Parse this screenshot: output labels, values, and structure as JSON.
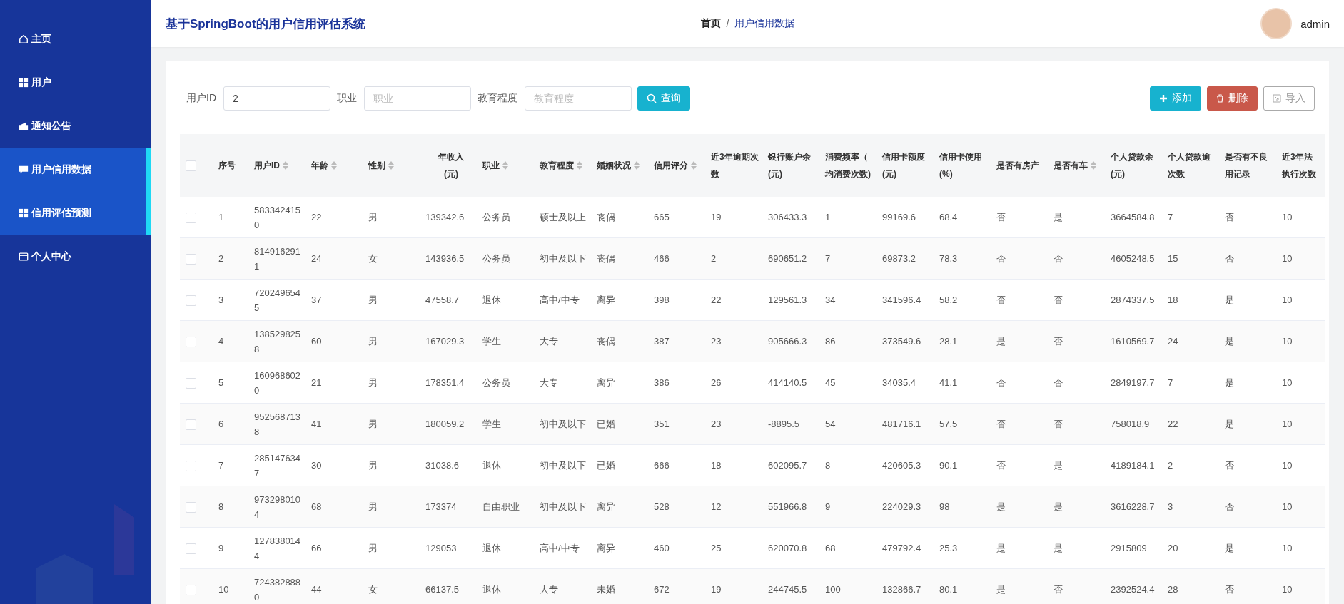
{
  "sidebar": {
    "items": [
      {
        "label": "主页",
        "kind": "home",
        "selected": false
      },
      {
        "label": "用户",
        "kind": "grid",
        "selected": false
      },
      {
        "label": "通知公告",
        "kind": "wallet",
        "selected": false
      },
      {
        "label": "用户信用数据",
        "kind": "chat",
        "selected": true
      },
      {
        "label": "信用评估预测",
        "kind": "grid",
        "selected": true
      },
      {
        "label": "个人中心",
        "kind": "card",
        "selected": false
      }
    ]
  },
  "header": {
    "title": "基于SpringBoot的用户信用评估系统",
    "breadcrumb": [
      "首页",
      "/",
      "用户信用数据"
    ],
    "user": "admin"
  },
  "filters": [
    {
      "label": "用户ID",
      "value": "2"
    },
    {
      "label": "职业",
      "placeholder": "职业"
    },
    {
      "label": "教育程度",
      "placeholder": "教育程度"
    }
  ],
  "search_button": "查询",
  "actions": [
    {
      "label": "添加",
      "kind": "add"
    },
    {
      "label": "删除",
      "kind": "delete"
    },
    {
      "label": "导入",
      "kind": "import"
    }
  ],
  "table": {
    "all_checked": false,
    "columns": [
      {
        "lines": [
          "序号"
        ],
        "sortable": false
      },
      {
        "lines": [
          "用户ID"
        ],
        "sortable": true
      },
      {
        "lines": [
          "年龄"
        ],
        "sortable": true
      },
      {
        "lines": [
          "性别"
        ],
        "sortable": true
      },
      {
        "lines": [
          "年收入",
          "(元)"
        ],
        "sortable": false
      },
      {
        "lines": [
          "职业"
        ],
        "sortable": true
      },
      {
        "lines": [
          "教育程度"
        ],
        "sortable": true
      },
      {
        "lines": [
          "婚姻状况"
        ],
        "sortable": true
      },
      {
        "lines": [
          "信用评分"
        ],
        "sortable": true
      },
      {
        "lines": [
          "近3年逾期次",
          "数"
        ],
        "sortable": false
      },
      {
        "lines": [
          "银行账户余",
          "(元)"
        ],
        "sortable": false
      },
      {
        "lines": [
          "消费频率（",
          "均消费次数)"
        ],
        "sortable": false
      },
      {
        "lines": [
          "信用卡额度",
          "(元)"
        ],
        "sortable": false
      },
      {
        "lines": [
          "信用卡使用",
          "(%)"
        ],
        "sortable": false
      },
      {
        "lines": [
          "是否有房产"
        ],
        "sortable": false
      },
      {
        "lines": [
          "是否有车"
        ],
        "sortable": true
      },
      {
        "lines": [
          "个人贷款余",
          "(元)"
        ],
        "sortable": false
      },
      {
        "lines": [
          "个人贷款逾",
          "次数"
        ],
        "sortable": false
      },
      {
        "lines": [
          "是否有不良",
          "用记录"
        ],
        "sortable": false
      },
      {
        "lines": [
          "近3年法",
          "执行次数"
        ],
        "sortable": false
      }
    ],
    "rows": [
      {
        "checked": false,
        "cells": [
          "1",
          "5833424150",
          "22",
          "男",
          "139342.6",
          "公务员",
          "硕士及以上",
          "丧偶",
          "665",
          "19",
          "306433.3",
          "1",
          "99169.6",
          "68.4",
          "否",
          "是",
          "3664584.8",
          "7",
          "否",
          "10"
        ]
      },
      {
        "checked": false,
        "cells": [
          "2",
          "8149162911",
          "24",
          "女",
          "143936.5",
          "公务员",
          "初中及以下",
          "丧偶",
          "466",
          "2",
          "690651.2",
          "7",
          "69873.2",
          "78.3",
          "否",
          "否",
          "4605248.5",
          "15",
          "否",
          "10"
        ]
      },
      {
        "checked": false,
        "cells": [
          "3",
          "7202496545",
          "37",
          "男",
          "47558.7",
          "退休",
          "高中/中专",
          "离异",
          "398",
          "22",
          "129561.3",
          "34",
          "341596.4",
          "58.2",
          "否",
          "否",
          "2874337.5",
          "18",
          "是",
          "10"
        ]
      },
      {
        "checked": false,
        "cells": [
          "4",
          "1385298258",
          "60",
          "男",
          "167029.3",
          "学生",
          "大专",
          "丧偶",
          "387",
          "23",
          "905666.3",
          "86",
          "373549.6",
          "28.1",
          "是",
          "否",
          "1610569.7",
          "24",
          "是",
          "10"
        ]
      },
      {
        "checked": false,
        "cells": [
          "5",
          "1609686020",
          "21",
          "男",
          "178351.4",
          "公务员",
          "大专",
          "离异",
          "386",
          "26",
          "414140.5",
          "45",
          "34035.4",
          "41.1",
          "否",
          "否",
          "2849197.7",
          "7",
          "是",
          "10"
        ]
      },
      {
        "checked": false,
        "cells": [
          "6",
          "9525687138",
          "41",
          "男",
          "180059.2",
          "学生",
          "初中及以下",
          "已婚",
          "351",
          "23",
          "-8895.5",
          "54",
          "481716.1",
          "57.5",
          "否",
          "否",
          "758018.9",
          "22",
          "是",
          "10"
        ]
      },
      {
        "checked": false,
        "cells": [
          "7",
          "2851476347",
          "30",
          "男",
          "31038.6",
          "退休",
          "初中及以下",
          "已婚",
          "666",
          "18",
          "602095.7",
          "8",
          "420605.3",
          "90.1",
          "否",
          "是",
          "4189184.1",
          "2",
          "否",
          "10"
        ]
      },
      {
        "checked": false,
        "cells": [
          "8",
          "9732980104",
          "68",
          "男",
          "173374",
          "自由职业",
          "初中及以下",
          "离异",
          "528",
          "12",
          "551966.8",
          "9",
          "224029.3",
          "98",
          "是",
          "是",
          "3616228.7",
          "3",
          "否",
          "10"
        ]
      },
      {
        "checked": false,
        "cells": [
          "9",
          "1278380144",
          "66",
          "男",
          "129053",
          "退休",
          "高中/中专",
          "离异",
          "460",
          "25",
          "620070.8",
          "68",
          "479792.4",
          "25.3",
          "是",
          "是",
          "2915809",
          "20",
          "是",
          "10"
        ]
      },
      {
        "checked": false,
        "cells": [
          "10",
          "7243828880",
          "44",
          "女",
          "66137.5",
          "退休",
          "大专",
          "未婚",
          "672",
          "19",
          "244745.5",
          "100",
          "132866.7",
          "80.1",
          "是",
          "否",
          "2392524.4",
          "28",
          "否",
          "10"
        ]
      }
    ]
  }
}
